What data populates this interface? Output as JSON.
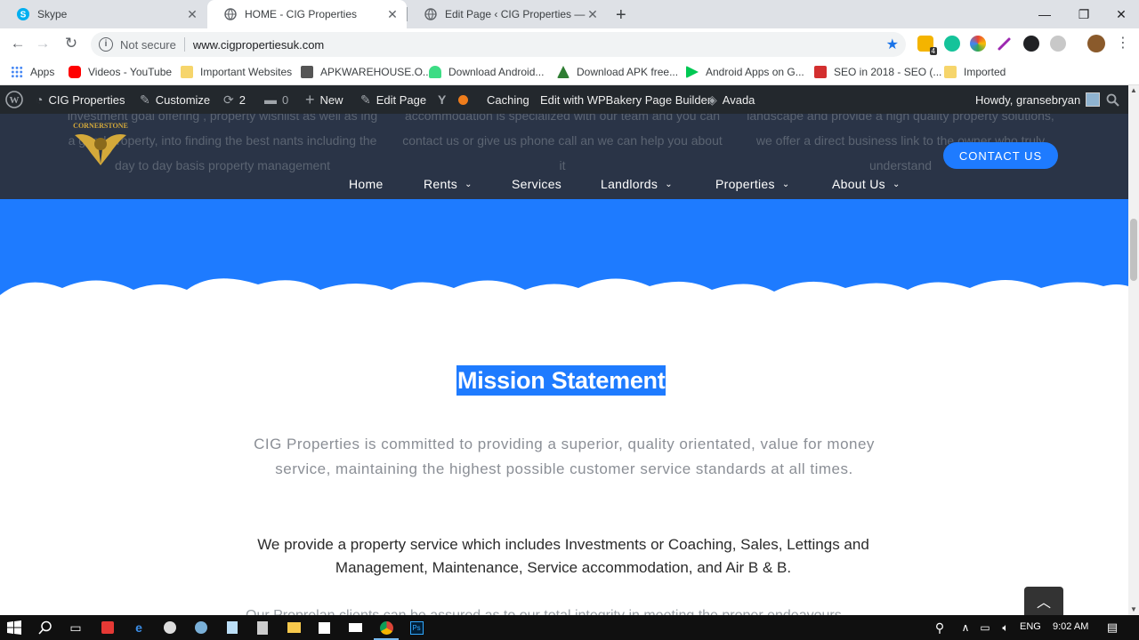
{
  "browser": {
    "tabs": [
      {
        "title": "Skype",
        "favicon": "skype-icon",
        "active": false
      },
      {
        "title": "HOME - CIG Properties",
        "favicon": "globe-icon",
        "active": true
      },
      {
        "title": "Edit Page ‹ CIG Properties — Wo",
        "favicon": "globe-icon",
        "active": false
      }
    ],
    "address": {
      "security_label": "Not secure",
      "url": "www.cigpropertiesuk.com"
    },
    "extension_badge": "4",
    "bookmarks": [
      {
        "label": "Apps",
        "icon": "apps-grid-icon"
      },
      {
        "label": "Videos - YouTube",
        "icon": "youtube-icon",
        "color": "#ff0000"
      },
      {
        "label": "Important Websites",
        "icon": "folder-icon",
        "color": "#f6d56b"
      },
      {
        "label": "APKWAREHOUSE.O...",
        "icon": "warehouse-icon",
        "color": "#555555"
      },
      {
        "label": "Download Android...",
        "icon": "android-icon",
        "color": "#3ddc84"
      },
      {
        "label": "Download APK free...",
        "icon": "apk-icon",
        "color": "#2e7d32"
      },
      {
        "label": "Android Apps on G...",
        "icon": "play-store-icon",
        "color": "#00c853"
      },
      {
        "label": "SEO in 2018 - SEO (...",
        "icon": "seo-icon",
        "color": "#d32f2f"
      },
      {
        "label": "Imported",
        "icon": "folder-icon",
        "color": "#f6d56b"
      }
    ]
  },
  "wp_admin_bar": {
    "site_name": "CIG Properties",
    "customize": "Customize",
    "updates": "2",
    "comments": "0",
    "new": "New",
    "edit_page": "Edit Page",
    "caching": "Caching",
    "wpbakery": "Edit with WPBakery Page Builder",
    "avada": "Avada",
    "howdy": "Howdy, gransebryan"
  },
  "site": {
    "logo_text": "CORNERSTONE",
    "nav": [
      {
        "label": "Home",
        "dropdown": false
      },
      {
        "label": "Rents",
        "dropdown": true
      },
      {
        "label": "Services",
        "dropdown": false
      },
      {
        "label": "Landlords",
        "dropdown": true
      },
      {
        "label": "Properties",
        "dropdown": true
      },
      {
        "label": "About Us",
        "dropdown": true
      }
    ],
    "contact_button": "CONTACT US",
    "ghost_text": {
      "col1": "investment goal offering , property wishlist as well as ing a good property, into finding the best nants including the day to day basis property management",
      "col2": "accommodation is specialized with our team and you can contact us or give us phone call an we can help you about it",
      "col3": "landscape and provide a high quality property solutions, we offer a direct business link to the owner who truly understand"
    },
    "accent_color": "#1e7bff"
  },
  "content": {
    "mission_title": "Mission Statement",
    "mission_text": "CIG Properties is committed to providing a superior, quality orientated, value for money service, maintaining the highest possible customer service standards at all times.",
    "services_text": "We provide a property service which includes Investments or Coaching, Sales, Lettings and Management, Maintenance, Service accommodation, and Air B & B.",
    "partial_text": "Our Proprelan clients can be assured as to our total integrity  in meeting the proper endeavours"
  },
  "taskbar": {
    "language": "ENG",
    "time": "9:02 AM"
  }
}
